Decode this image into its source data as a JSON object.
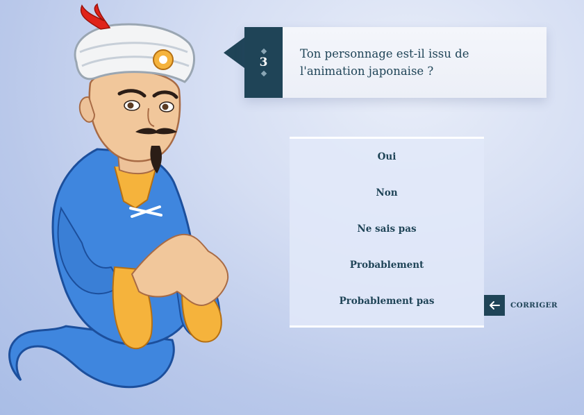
{
  "question": {
    "number": "3",
    "text": "Ton personnage est-il issu de l'animation japonaise ?"
  },
  "answers": [
    {
      "label": "Oui"
    },
    {
      "label": "Non"
    },
    {
      "label": "Ne sais pas"
    },
    {
      "label": "Probablement"
    },
    {
      "label": "Probablement pas"
    }
  ],
  "correct": {
    "label": "CORRIGER",
    "icon": "arrow-left-icon"
  },
  "character": {
    "icon": "akinator-genie-illustration"
  },
  "colors": {
    "primary": "#1f4457",
    "genie_shirt": "#3f86de",
    "turban": "#f3f4f5",
    "cuff": "#f5b33c"
  }
}
